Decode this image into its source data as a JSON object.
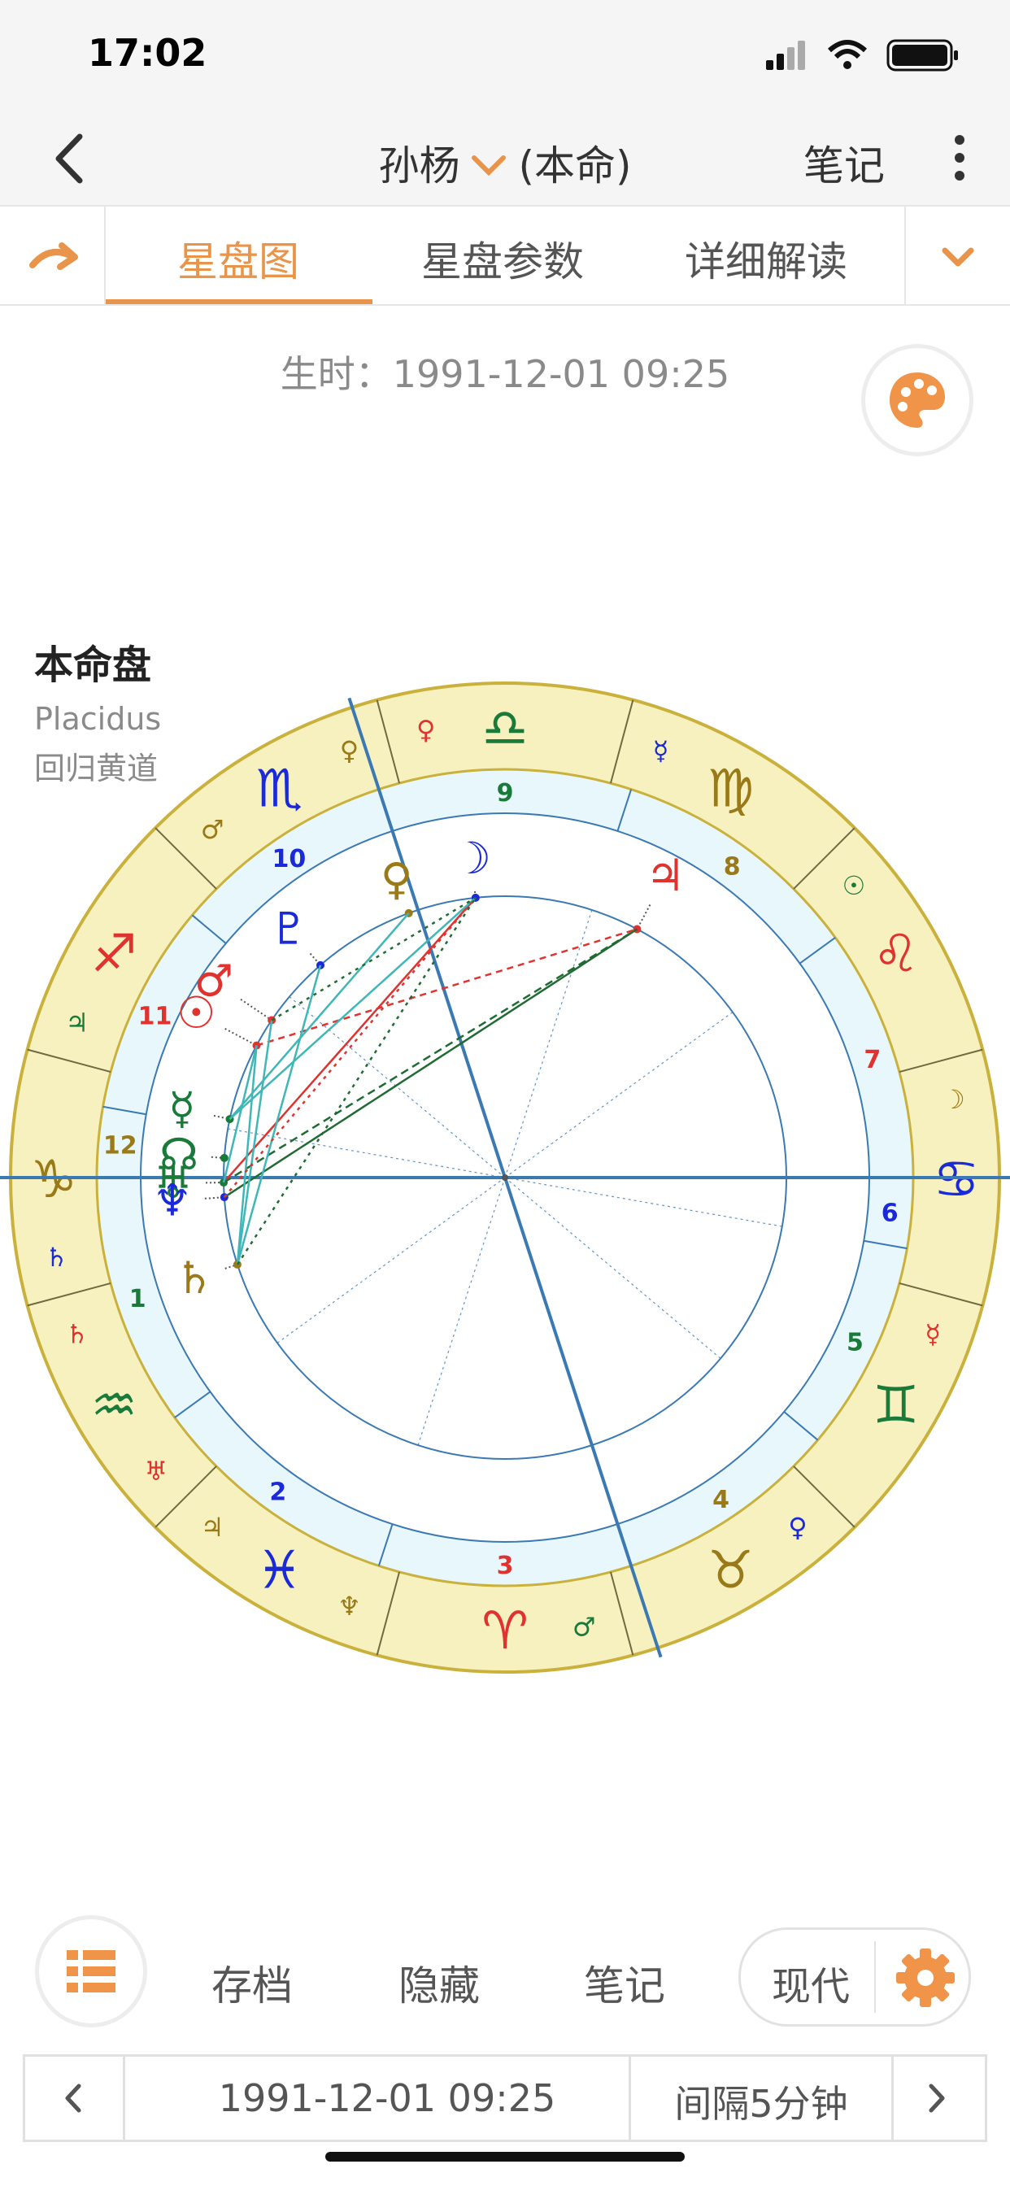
{
  "status_bar": {
    "time": "17:02"
  },
  "nav": {
    "title_name": "孙杨",
    "title_suffix": "(本命)",
    "notes_label": "笔记"
  },
  "tabs": [
    {
      "label": "星盘图",
      "active": true
    },
    {
      "label": "星盘参数",
      "active": false
    },
    {
      "label": "详细解读",
      "active": false
    }
  ],
  "birth_time": "生时：1991-12-01 09:25",
  "chart_label": {
    "title": "本命盘",
    "house_system": "Placidus",
    "zodiac": "回归黄道"
  },
  "chart_data": {
    "type": "natal-wheel",
    "sign_order_from_asc_ccw": [
      "♑",
      "♒",
      "♓",
      "♈",
      "♉",
      "♊",
      "♋",
      "♌",
      "♍",
      "♎",
      "♏",
      "♐"
    ],
    "house_numbers": [
      "1",
      "2",
      "3",
      "4",
      "5",
      "6",
      "7",
      "8",
      "9",
      "10",
      "11",
      "12"
    ],
    "rulers": [
      {
        "sign": "♑",
        "glyphs": [
          "♄"
        ]
      },
      {
        "sign": "♒",
        "glyphs": [
          "♅",
          "♄"
        ]
      },
      {
        "sign": "♓",
        "glyphs": [
          "♆",
          "♃"
        ]
      },
      {
        "sign": "♈",
        "glyphs": [
          "♂"
        ]
      },
      {
        "sign": "♉",
        "glyphs": [
          "♀"
        ]
      },
      {
        "sign": "♊",
        "glyphs": [
          "☿"
        ]
      },
      {
        "sign": "♋",
        "glyphs": [
          "☽"
        ]
      },
      {
        "sign": "♌",
        "glyphs": [
          "☉"
        ]
      },
      {
        "sign": "♍",
        "glyphs": [
          "☿"
        ]
      },
      {
        "sign": "♎",
        "glyphs": [
          "♀"
        ]
      },
      {
        "sign": "♏",
        "glyphs": [
          "♂",
          "♀"
        ]
      },
      {
        "sign": "♐",
        "glyphs": [
          "♃"
        ]
      }
    ],
    "planets": [
      {
        "glyph": "☉",
        "name": "sun"
      },
      {
        "glyph": "♂",
        "name": "mars"
      },
      {
        "glyph": "♇",
        "name": "pluto"
      },
      {
        "glyph": "♀",
        "name": "venus"
      },
      {
        "glyph": "☽",
        "name": "moon"
      },
      {
        "glyph": "♃",
        "name": "jupiter"
      },
      {
        "glyph": "☿",
        "name": "mercury"
      },
      {
        "glyph": "☊",
        "name": "node"
      },
      {
        "glyph": "♅",
        "name": "uranus"
      },
      {
        "glyph": "♆",
        "name": "neptune"
      },
      {
        "glyph": "♄",
        "name": "saturn"
      }
    ],
    "colors": {
      "fire": "#e0332f",
      "earth": "#9a7a18",
      "air": "#1a7a3a",
      "water": "#1a2ad8",
      "ring_outer": "#f7f1c0",
      "ring_inner": "#e8f7fc",
      "ring_border": "#c9b13c",
      "house_line": "#3b79b3"
    }
  },
  "bottom_bar": {
    "archive": "存档",
    "hide": "隐藏",
    "notes": "笔记",
    "mode": "现代"
  },
  "time_bar": {
    "datetime": "1991-12-01 09:25",
    "interval": "间隔5分钟"
  }
}
